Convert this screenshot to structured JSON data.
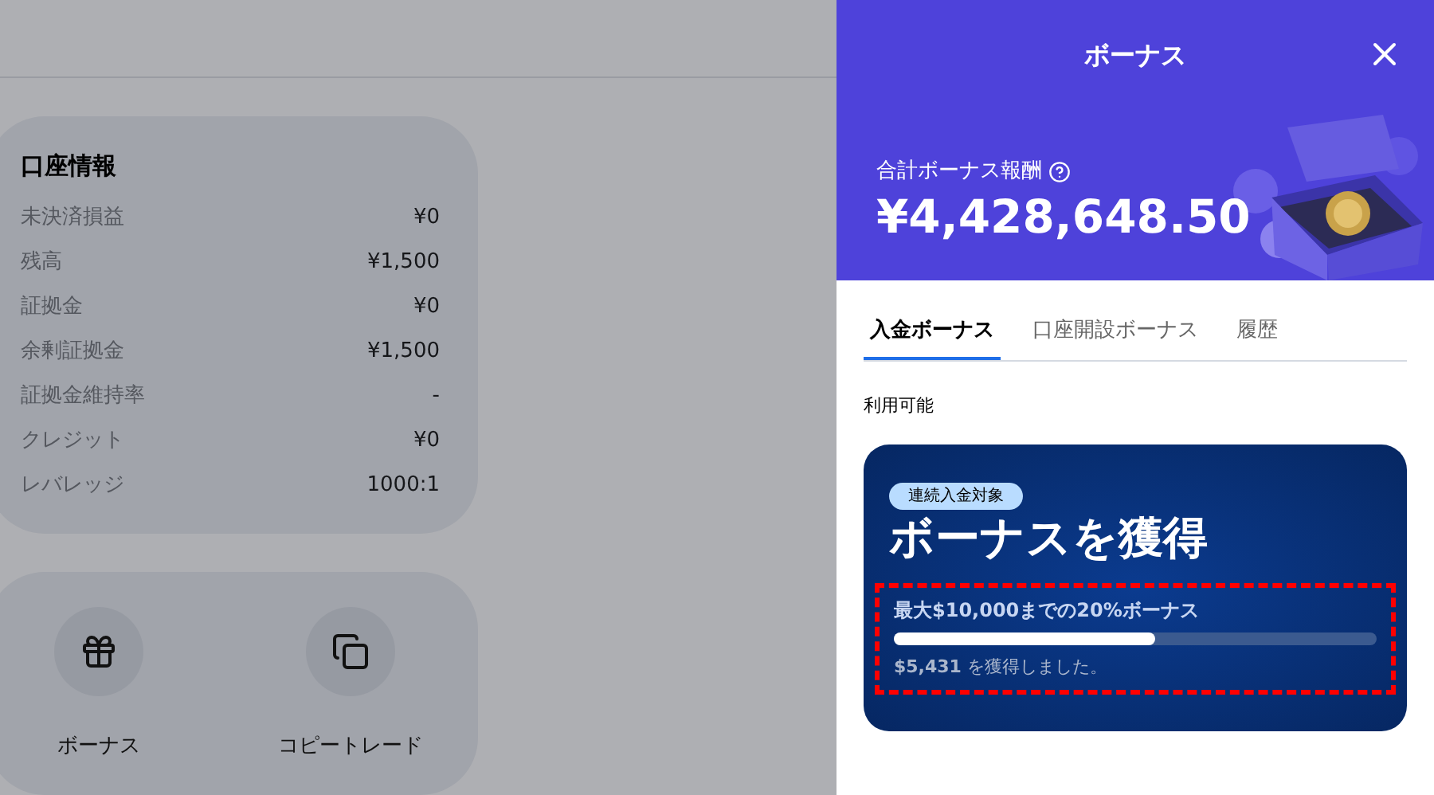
{
  "account_info": {
    "title": "口座情報",
    "rows": [
      {
        "label": "未決済損益",
        "value": "¥0"
      },
      {
        "label": "残高",
        "value": "¥1,500"
      },
      {
        "label": "証拠金",
        "value": "¥0"
      },
      {
        "label": "余剰証拠金",
        "value": "¥1,500"
      },
      {
        "label": "証拠金維持率",
        "value": "-"
      },
      {
        "label": "クレジット",
        "value": "¥0"
      },
      {
        "label": "レバレッジ",
        "value": "1000:1"
      }
    ]
  },
  "shortcuts": [
    {
      "kind": "gift",
      "label": "ボーナス"
    },
    {
      "kind": "copy",
      "label": "コピートレード"
    }
  ],
  "panel": {
    "title": "ボーナス",
    "total_label": "合計ボーナス報酬",
    "total_value": "¥4,428,648.50",
    "tabs": [
      {
        "label": "入金ボーナス",
        "selected": true
      },
      {
        "label": "口座開設ボーナス",
        "selected": false
      },
      {
        "label": "履歴",
        "selected": false
      }
    ],
    "section_label": "利用可能",
    "bonus_card": {
      "badge": "連続入金対象",
      "headline": "ボーナスを獲得",
      "offer": "最大$10,000までの20%ボーナス",
      "level": 0.54,
      "progress_text": "**$5,431** を獲得しました。",
      "highlighted": true
    }
  }
}
